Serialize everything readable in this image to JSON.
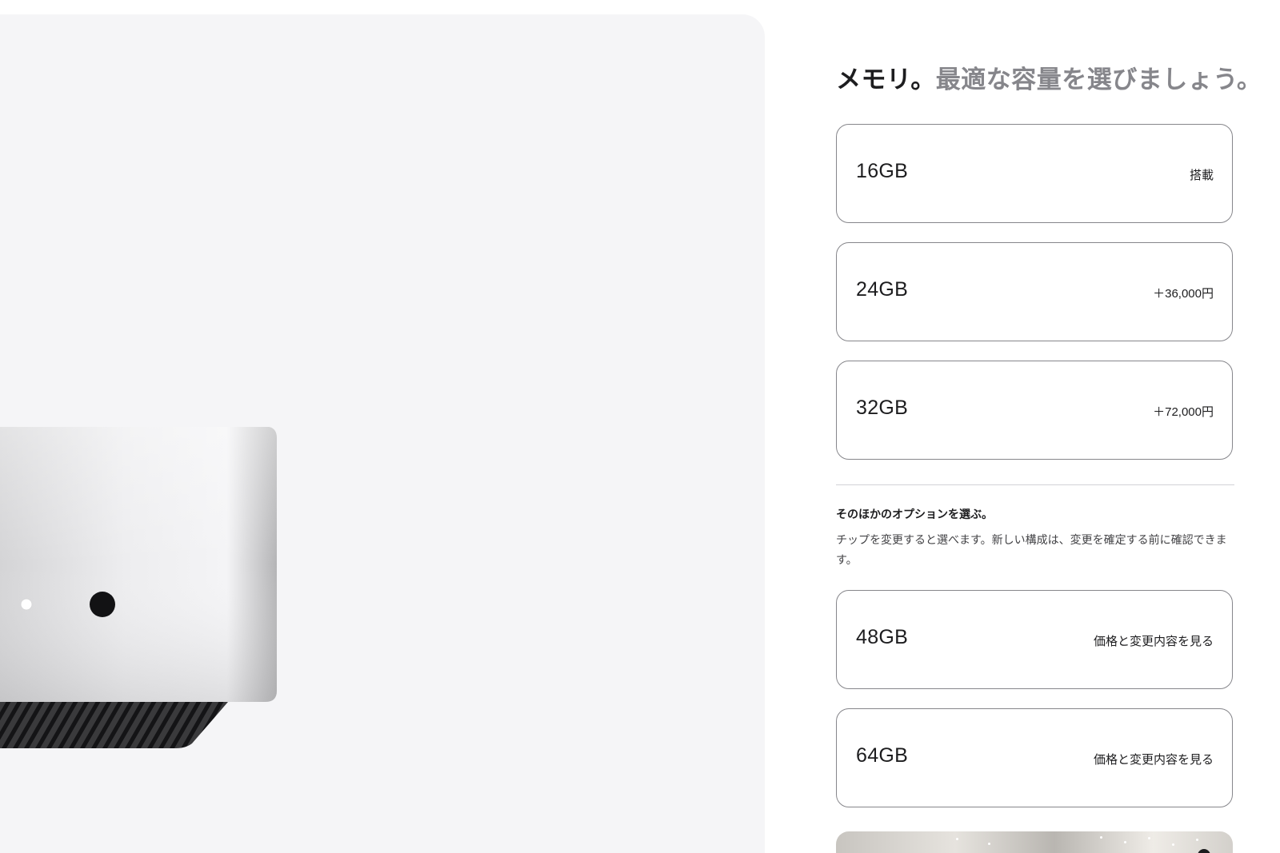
{
  "memory": {
    "headline_strong": "メモリ。",
    "headline_muted": "最適な容量を選びましょう。",
    "options": [
      {
        "size": "16GB",
        "price": "搭載"
      },
      {
        "size": "24GB",
        "price": "＋36,000円"
      },
      {
        "size": "32GB",
        "price": "＋72,000円"
      }
    ]
  },
  "other_options": {
    "title": "そのほかのオプションを選ぶ。",
    "description": "チップを変更すると選べます。新しい構成は、変更を確定する前に確認できます。",
    "options": [
      {
        "size": "48GB",
        "action": "価格と変更内容を見る"
      },
      {
        "size": "64GB",
        "action": "価格と変更内容を見る"
      }
    ]
  },
  "colors": {
    "panel_background": "#f5f5f7",
    "option_border": "#86868b",
    "text_primary": "#1d1d1f",
    "text_muted": "#86868b"
  },
  "icons": {
    "product_image": "mac-mini-product-image",
    "promo_image": "store-interior-image"
  }
}
